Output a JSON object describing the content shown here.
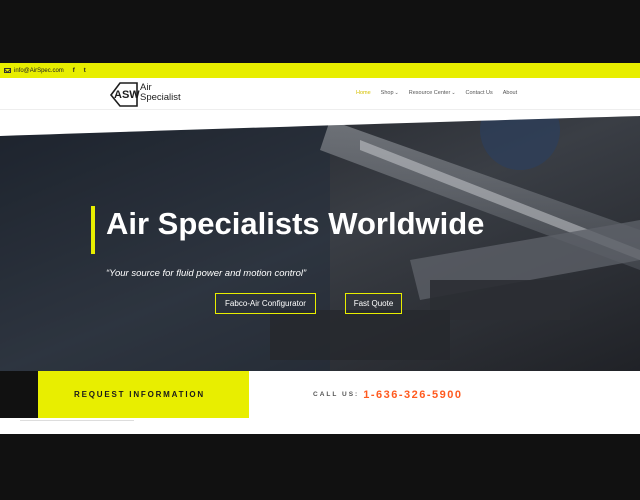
{
  "topbar": {
    "email": "info@AirSpec.com",
    "social": [
      "f",
      "t"
    ]
  },
  "brand": {
    "logo_mark": "ASW",
    "name_line1": "Air",
    "name_line2": "Specialist"
  },
  "nav": {
    "items": [
      {
        "label": "Home",
        "active": true
      },
      {
        "label": "Shop",
        "caret": "⌄"
      },
      {
        "label": "Resource Center",
        "caret": "⌄"
      },
      {
        "label": "Contact Us"
      },
      {
        "label": "About"
      }
    ]
  },
  "hero": {
    "title": "Air Specialists Worldwide",
    "subtitle": "“Your source for fluid power and motion control”",
    "buttons": [
      {
        "label": "Fabco-Air Configurator"
      },
      {
        "label": "Fast Quote"
      }
    ]
  },
  "cta": {
    "request_label": "REQUEST INFORMATION",
    "call_label": "CALL US:",
    "phone": "1-636-326-5900"
  },
  "colors": {
    "accent": "#e8ee00",
    "phone": "#ff5a1f",
    "nav_active": "#d6c000"
  }
}
